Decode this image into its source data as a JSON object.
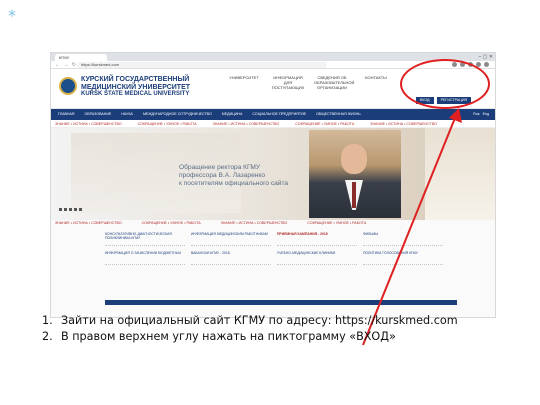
{
  "decor": {
    "star": "*"
  },
  "browser": {
    "tab_title": "КГМУ",
    "window_controls": "–  ▢  ✕",
    "nav_buttons": "← → ↻",
    "url": "https://kurskmed.com"
  },
  "site": {
    "name_ru_1": "КУРСКИЙ ГОСУДАРСТВЕННЫЙ",
    "name_ru_2": "МЕДИЦИНСКИЙ УНИВЕРСИТЕТ",
    "name_en": "KURSK STATE MEDICAL UNIVERSITY",
    "header_links": [
      "УНИВЕРСИТЕТ",
      "ИНФОРМАЦИЯ ДЛЯ ПОСТУПАЮЩИХ",
      "СВЕДЕНИЯ ОБ ОБРАЗОВАТЕЛЬНОЙ ОРГАНИЗАЦИИ",
      "КОНТАКТЫ"
    ],
    "login_label": "ВХОД",
    "register_label": "РЕГИСТРАЦИЯ",
    "menu": [
      "ГЛАВНАЯ",
      "ОБРАЗОВАНИЕ",
      "НАУКА",
      "МЕЖДУНАРОДНОЕ СОТРУДНИЧЕСТВО",
      "МЕДИЦИНА",
      "СОЦИАЛЬНОЕ ПРЕДПРИЯТИЕ",
      "ОБЩЕСТВЕННАЯ ЖИЗНЬ"
    ],
    "lang": [
      "Rus",
      "Eng"
    ],
    "ticker": [
      "ЗНАНИЕ • ИСТИНА • СОВЕРШЕНСТВО",
      "СОКРАЩЕНИЕ • УМНОЕ • РАБОТА",
      "ЗНАНИЕ • ИСТИНА • СОВЕРШЕНСТВО",
      "СОКРАЩЕНИЕ • УМНОЕ • РАБОТА",
      "ЗНАНИЕ • ИСТИНА • СОВЕРШЕНСТВО"
    ],
    "banner_line1": "Обращение ректора КГМУ",
    "banner_line2": "профессора В.А. Лазаренко",
    "banner_line3": "к посетителям официального сайта",
    "ticker2": [
      "ЗНАНИЕ • ИСТИНА • СОВЕРШЕНСТВО",
      "СОКРАЩЕНИЕ • УМНОЕ • РАБОТА",
      "ЗНАНИЕ • ИСТИНА • СОВЕРШЕНСТВО",
      "СОКРАЩЕНИЕ • УМНОЕ • РАБОТА"
    ],
    "links": [
      "КОНСУЛЬТАТИВНО-ДИАГНОСТИЧЕСКАЯ ПОЛИКЛИНИКА КГМУ",
      "ИНФОРМАЦИЯ МЕДИЦИНСКИМ РАБОТНИКАМ",
      "ПРИЕМНАЯ КАМПАНИЯ - 2018",
      "ФИЛЬМЫ",
      "ИНФОРМАЦИЯ О ЗАЧИСЛЕНИИ БЮДЖЕТНЫХ",
      "ВАКАНСИИ КГМУ - 2018",
      "УЧЕБНО-МЕДИЦИНСКИЕ КЛИНИКИ",
      "ПОЛИТИКА ГОЛОСОВАНИЯ КГМУ"
    ]
  },
  "steps": [
    {
      "num": "1.",
      "text": "Зайти на официальный сайт КГМУ по адресу: https://kurskmed.com"
    },
    {
      "num": "2.",
      "text": "В правом верхнем углу нажать на пиктограмму «ВХОД»"
    }
  ]
}
